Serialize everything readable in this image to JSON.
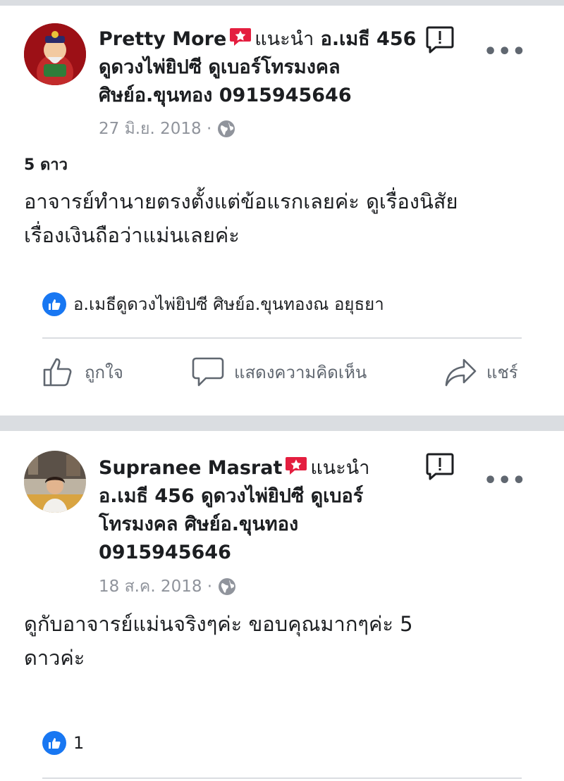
{
  "post1": {
    "author": "Pretty More",
    "recommends_word": "แนะนำ",
    "page_name_part1": "อ.เมธี 456",
    "page_name_line2": "ดูดวงไพ่ยิปซี ดูเบอร์โทรมงคล",
    "page_name_line3": "ศิษย์อ.ขุนทอง 0915945646",
    "date": "27 มิ.ย. 2018 ·",
    "rating": "5 ดาว",
    "text_line1": "อาจารย์ทำนายตรงตั้งแต่ข้อแรกเลยค่ะ ดูเรื่องนิสัย",
    "text_line2": "เรื่องเงินถือว่าแม่นเลยค่ะ",
    "likers": "อ.เมธีดูดวงไพ่ยิปซี ศิษย์อ.ขุนทองณ อยุธยา",
    "actions": {
      "like": "ถูกใจ",
      "comment": "แสดงความคิดเห็น",
      "share": "แชร์"
    }
  },
  "post2": {
    "author": "Supranee Masrat",
    "recommends_word": "แนะนำ",
    "page_name_line2": "อ.เมธี 456 ดูดวงไพ่ยิปซี ดูเบอร์",
    "page_name_line3": "โทรมงคล ศิษย์อ.ขุนทอง",
    "page_name_line4": "0915945646",
    "date": "18 ส.ค. 2018 ·",
    "text_line1": "ดูกับอาจารย์แม่นจริงๆค่ะ ขอบคุณมากๆค่ะ 5",
    "text_line2": "ดาวค่ะ",
    "like_count": "1"
  },
  "more_label": "•••",
  "colors": {
    "facebook_blue": "#1877f2",
    "recommend_red": "#e41e3f",
    "separator": "#dadde1",
    "meta_gray": "#90949c"
  }
}
